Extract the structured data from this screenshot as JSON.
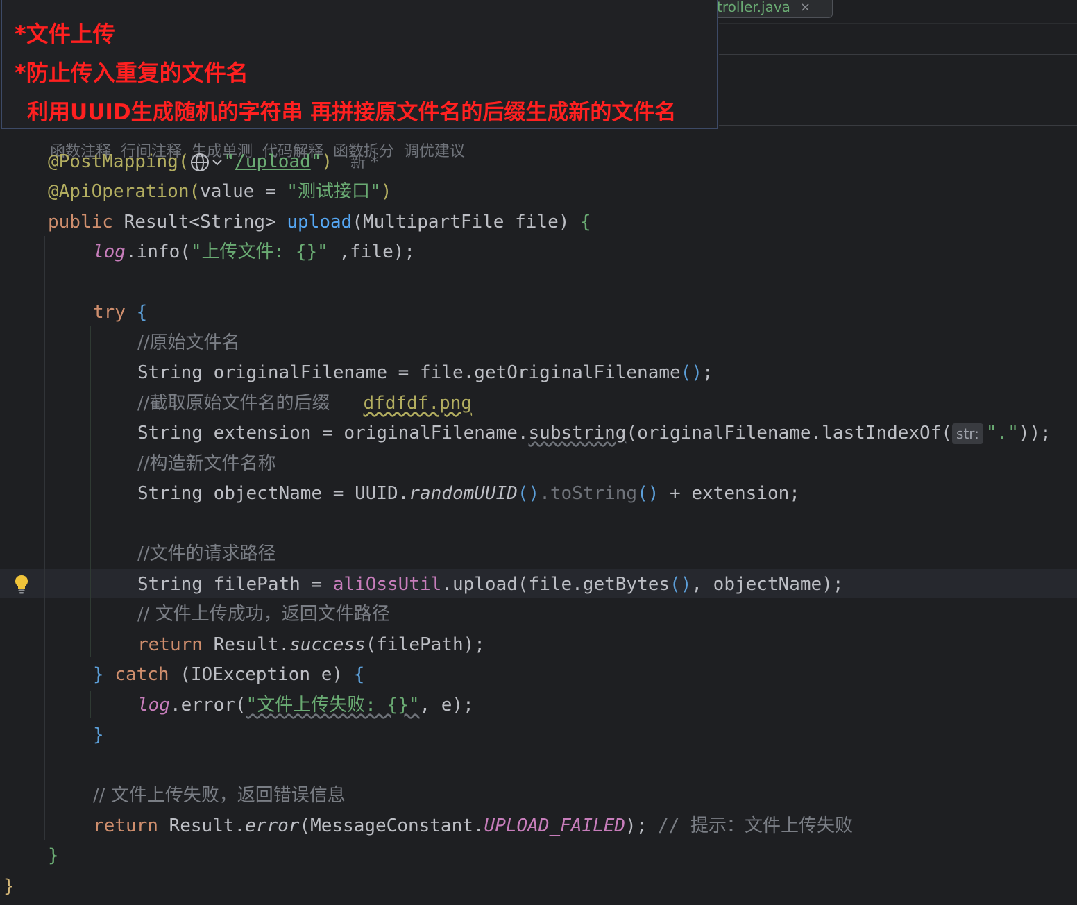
{
  "tab": {
    "title": "troller.java",
    "close": "×"
  },
  "annotation": {
    "line1": "*文件上传",
    "line2": "*防止传入重复的文件名",
    "line3": "利用UUID生成随机的字符串 再拼接原文件名的后缀生成新的文件名"
  },
  "inlay_actions": "函数注释  行间注释  生成单测  代码解释  函数拆分  调优建议",
  "code": {
    "l1_annotation": "@PostMapping(",
    "l1_path_quote_open": "\"",
    "l1_path": "/upload",
    "l1_path_quote_close": "\"",
    "l1_close": ")",
    "l1_hint": "新 *",
    "l2_annotation": "@ApiOperation(",
    "l2_param": "value = ",
    "l2_value": "\"测试接口\"",
    "l2_close": ")",
    "l3_kw": "public ",
    "l3_type": "Result<String> ",
    "l3_method": "upload",
    "l3_params": "(MultipartFile file) ",
    "l3_brace": "{",
    "l4_log": "log",
    "l4_call": ".info(",
    "l4_str": "\"上传文件: {}\"",
    "l4_rest": " ,file);",
    "l5_kw": "try ",
    "l5_brace": "{",
    "l6_comment": "//原始文件名",
    "l7_code": "String originalFilename = file.getOriginalFilename",
    "l7_paren": "()",
    "l7_end": ";",
    "l8_comment": "//截取原始文件名的后缀",
    "l8_example": "dfdfdf.png",
    "l9_start": "String extension = originalFilename.",
    "l9_substring": "substring",
    "l9_mid": "(originalFilename.lastIndexOf(",
    "l9_hint": "str:",
    "l9_str": "\".\"",
    "l9_end": "));",
    "l10_comment": "//构造新文件名称",
    "l11_start": "String objectName = UUID.",
    "l11_method": "randomUUID",
    "l11_paren1": "()",
    "l11_tostring": ".toString",
    "l11_paren2": "()",
    "l11_end": " + extension;",
    "l12_comment": "//文件的请求路径",
    "l13_start": "String filePath = ",
    "l13_field": "aliOssUtil",
    "l13_mid": ".upload(file.getBytes",
    "l13_paren": "()",
    "l13_end": ", objectName);",
    "l14_comment": "// 文件上传成功，返回文件路径",
    "l15_kw": "return ",
    "l15_cls": "Result.",
    "l15_method": "success",
    "l15_end": "(filePath);",
    "l16_brace_close": "} ",
    "l16_kw": "catch ",
    "l16_params": "(IOException e) ",
    "l16_brace": "{",
    "l17_log": "log",
    "l17_call": ".error(",
    "l17_str": "\"文件上传失败: {}\"",
    "l17_end": ", e);",
    "l18_brace": "}",
    "l19_comment": "// 文件上传失败，返回错误信息",
    "l20_kw": "return ",
    "l20_cls": "Result.",
    "l20_method": "error",
    "l20_mid": "(MessageConstant.",
    "l20_const": "UPLOAD_FAILED",
    "l20_end": "); ",
    "l20_comment_slash": "// ",
    "l20_comment": "提示：文件上传失败",
    "l21_brace": "}",
    "l22_brace": "}"
  },
  "colors": {
    "background": "#1e1f22",
    "keyword": "#cf8e6d",
    "annotation": "#b3ae60",
    "string": "#6aab73",
    "method": "#56a8f5",
    "field": "#c77dbb",
    "comment": "#7a7e85",
    "annotation_text": "#ff2020"
  },
  "icons": {
    "globe": "globe-icon",
    "chevron": "chevron-down-icon",
    "bulb": "lightbulb-icon"
  }
}
